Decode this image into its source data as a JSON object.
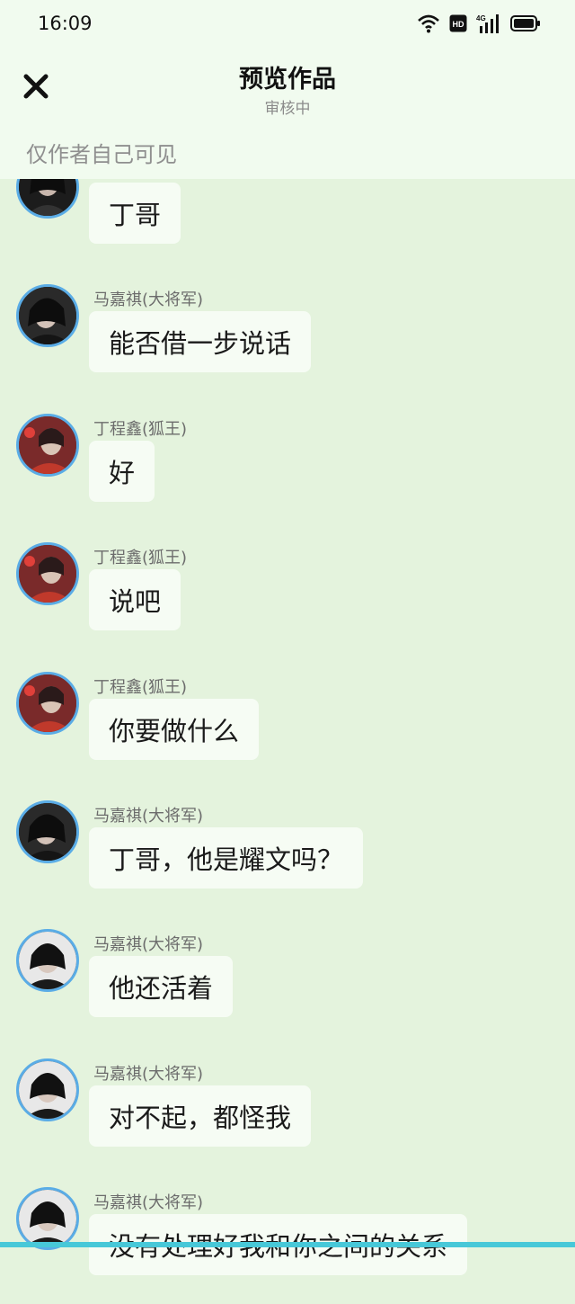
{
  "status_bar": {
    "time": "16:09",
    "icons": [
      "wifi-icon",
      "hd-icon",
      "signal-4g-icon",
      "battery-icon"
    ]
  },
  "header": {
    "title": "预览作品",
    "subtitle": "审核中",
    "notice": "仅作者自己可见"
  },
  "messages": [
    {
      "name": "",
      "text": "丁哥",
      "avatar": "dark"
    },
    {
      "name": "马嘉祺(大将军)",
      "text": "能否借一步说话",
      "avatar": "dark"
    },
    {
      "name": "丁程鑫(狐王)",
      "text": "好",
      "avatar": "red"
    },
    {
      "name": "丁程鑫(狐王)",
      "text": "说吧",
      "avatar": "red"
    },
    {
      "name": "丁程鑫(狐王)",
      "text": "你要做什么",
      "avatar": "red"
    },
    {
      "name": "马嘉祺(大将军)",
      "text": "丁哥，他是耀文吗？",
      "avatar": "dark"
    },
    {
      "name": "马嘉祺(大将军)",
      "text": "他还活着",
      "avatar": "dark"
    },
    {
      "name": "马嘉祺(大将军)",
      "text": "对不起，都怪我",
      "avatar": "dark"
    },
    {
      "name": "马嘉祺(大将军)",
      "text": "没有处理好我和你之间的关系",
      "avatar": "dark"
    }
  ],
  "colors": {
    "header_bg": "#f1fbef",
    "chat_bg": "#e4f3dd",
    "bubble_bg": "#f6fcf4",
    "avatar_ring": "#5aace6"
  }
}
